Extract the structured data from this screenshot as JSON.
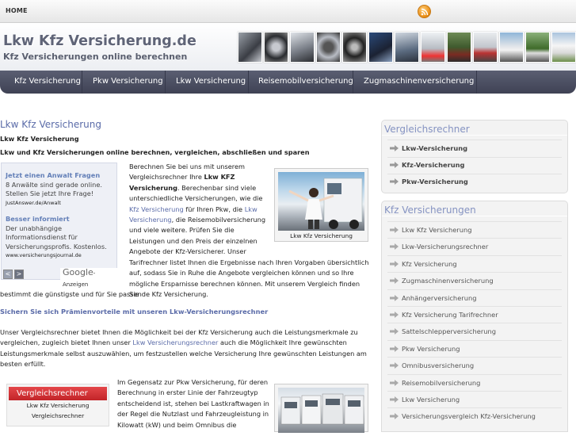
{
  "topbar": {
    "home": "HOME",
    "rss_icon": "rss-icon"
  },
  "header": {
    "title": "Lkw Kfz Versicherung.de",
    "subtitle": "Kfz Versicherungen online berechnen"
  },
  "nav": [
    {
      "label": "Kfz Versicherung"
    },
    {
      "label": "Pkw Versicherung"
    },
    {
      "label": "Lkw Versicherung"
    },
    {
      "label": "Reisemobilversicherung"
    },
    {
      "label": "Zugmaschinenversicherung"
    }
  ],
  "main": {
    "title": "Lkw Kfz Versicherung",
    "heading1": "Lkw Kfz Versicherung",
    "heading2": "Lkw und Kfz Versicherungen online berechnen, vergleichen, abschließen und sparen",
    "intro_lines": [
      "Berechnen Sie bei uns mit unserem",
      "Vergleichsrechner Ihre",
      "Versicherung",
      "Kfz Versicherung",
      "Versicherung",
      "und viele weitere. Prüfen Sie die",
      "Leistungen und den Preis der einzelnen",
      "Angebote der Kfz-Versicherer. Unser"
    ],
    "intro_bold": "Lkw KFZ",
    "intro_mid1": ". Berechenbar sind viele",
    "intro_mid2": "unterschiedliche Versicherungen, wie die",
    "intro_link1": "Kfz Versicherung",
    "intro_mid3": " für Ihren Pkw, die ",
    "intro_link2": "Lkw",
    "intro_link3": "Versicherung",
    "intro_mid4": ", die Reisemobilversicherung",
    "intro_rest": "Tarifrechner listet Ihnen die Ergebnisse nach Ihren Vorgaben übersichtlich auf, sodass Sie in Ruhe die Angebote vergleichen können und so Ihre mögliche Ersparnisse berechnen können. Mit unserem Vergleich finden Sie",
    "intro_last": "bestimmt die günstigste und für Sie passende Kfz Versicherung.",
    "image_caption": "Lkw Kfz Versicherung",
    "subheading": "Sichern Sie sich Prämienvorteile mit unseren Lkw-Versicherungsrechner",
    "p2_a": "Unser Vergleichsrechner bietet Ihnen die Möglichkeit bei der Kfz Versicherung auch die Leistungsmerkmale zu",
    "p2_b": "vergleichen, zugleich bietet Ihnen unser ",
    "p2_link": "Lkw Versicherungsrechner",
    "p2_c": " auch die Möglichkeit Ihre gewünschten",
    "p2_d": "Leistungsmerkmale selbst auszuwählen, um festzustellen welche Versicherung Ihre gewünschten Leistungen am",
    "p2_e": "besten erfüllt.",
    "p3_lines": [
      "Im Gegensatz zur Pkw Versicherung, für deren",
      "Berechnung in erster Linie der Fahrzeugtyp",
      "entscheidend ist, stehen bei Lastkraftwagen in",
      "der Regel die Nutzlast und Fahrzeugleistung in",
      "Kilowatt (kW) und beim Omnibus die"
    ],
    "vgl_btn": "Vergleichsrechner",
    "vgl_line1": "Lkw Kfz Versicherung",
    "vgl_line2": "Vergleichsrechner"
  },
  "ads": {
    "ad1_title": "Jetzt einen Anwalt Fragen",
    "ad1_l1": "8 Anwälte sind gerade online.",
    "ad1_l2": "Stellen Sie jetzt Ihre Frage!",
    "ad1_url": "JustAnswer.de/Anwalt",
    "ad2_title": "Besser informiert",
    "ad2_l1": "Der unabhängige",
    "ad2_l2": "Informationsdienst für",
    "ad2_l3": "Versicherungsprofis. Kostenlos.",
    "ad2_url": "www.versicherungsjournal.de",
    "google": "Google",
    "anzeigen": "-Anzeigen",
    "prev": "<",
    "next": ">"
  },
  "sidebar": {
    "panel1_title": "Vergleichsrechner",
    "panel1_items": [
      "Lkw-Versicherung",
      "Kfz-Versicherung",
      "Pkw-Versicherung"
    ],
    "panel2_title": "Kfz Versicherungen",
    "panel2_items": [
      "Lkw Kfz Versicherung",
      "Lkw-Versicherungsrechner",
      "Kfz Versicherung",
      "Zugmaschinenversicherung",
      "Anhängerversicherung",
      "Kfz Versicherung Tarifrechner",
      "Sattelschlepperversicherung",
      "Pkw Versicherung",
      "Omnibusversicherung",
      "Reisemobilversicherung",
      "Lkw Versicherung",
      "Versicherungsvergleich Kfz-Versicherung"
    ]
  },
  "colors": {
    "nav_bg": "#4a4d61",
    "link": "#5a6ba8",
    "panel_title": "#8593c2",
    "button": "#d03336"
  }
}
